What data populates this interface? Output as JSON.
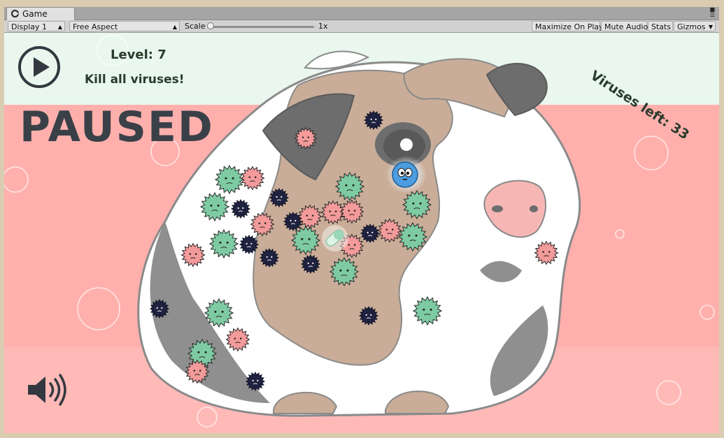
{
  "window": {
    "tab_label": "Game",
    "tab_icon": "unity-logo-icon"
  },
  "toolbar": {
    "display": "Display 1",
    "aspect": "Free Aspect",
    "scale_label": "Scale",
    "scale_value": "1x",
    "maximize_on_play": "Maximize On Play",
    "mute_audio": "Mute Audio",
    "stats": "Stats",
    "gizmos": "Gizmos"
  },
  "hud": {
    "level": "Level: 7",
    "objective": "Kill all viruses!",
    "viruses_left": "Viruses left: 33",
    "paused": "PAUSED"
  },
  "colors": {
    "sky": "#e9f7ee",
    "pink_bg": "#ffb0ad",
    "text_dark": "#2a3b2c",
    "paused_text": "#3a4048",
    "virus_red": "#f39a9a",
    "virus_green": "#7ecba3",
    "virus_navy": "#1f2340",
    "pig_brown": "#c9ad98",
    "pig_grey": "#6d6d6d",
    "player_blue": "#4c9ddf"
  },
  "icons": {
    "play": "play-icon",
    "sound": "speaker-icon",
    "player": "blue-blob-player-icon",
    "pill": "pill-powerup-icon"
  }
}
